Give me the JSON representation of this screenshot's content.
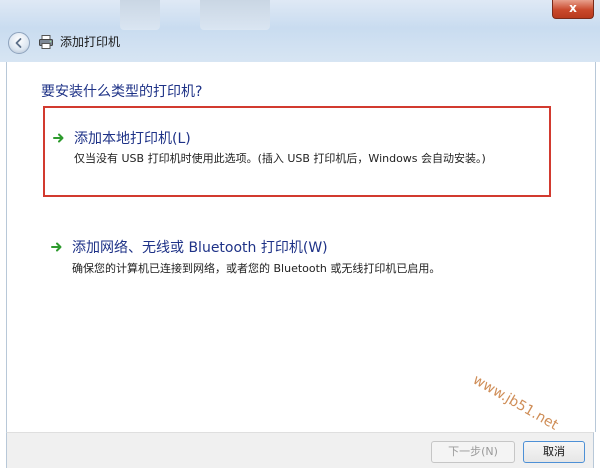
{
  "window": {
    "title": "添加打印机",
    "close_glyph": "x"
  },
  "content": {
    "question": "要安装什么类型的打印机?",
    "options": [
      {
        "title": "添加本地打印机(L)",
        "description": "仅当没有 USB 打印机时使用此选项。(插入 USB 打印机后，Windows 会自动安装。)",
        "highlighted": true
      },
      {
        "title": "添加网络、无线或 Bluetooth 打印机(W)",
        "description": "确保您的计算机已连接到网络，或者您的 Bluetooth 或无线打印机已启用。",
        "highlighted": false
      }
    ]
  },
  "footer": {
    "next_label": "下一步(N)",
    "cancel_label": "取消"
  },
  "watermark": "www.jb51.net",
  "colors": {
    "link_text": "#1e3287",
    "highlight_border": "#d23a2f",
    "arrow_green": "#2e9b2e"
  },
  "icons": [
    "back-arrow-icon",
    "printer-icon",
    "green-arrow-icon"
  ]
}
